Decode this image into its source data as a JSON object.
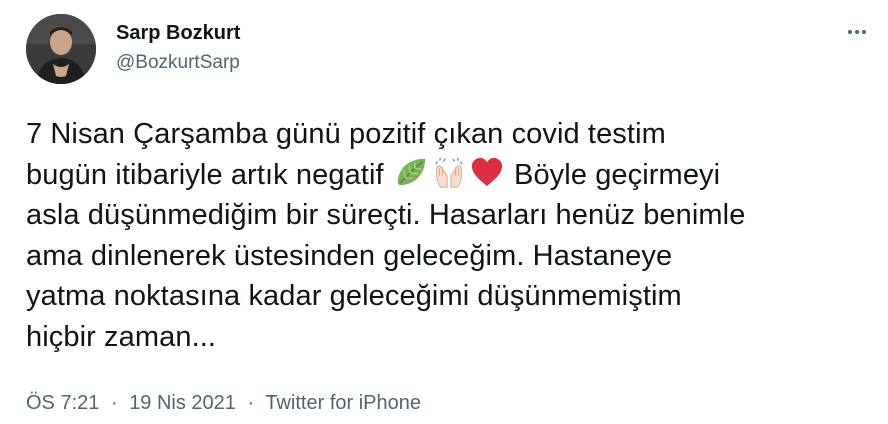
{
  "author": {
    "display_name": "Sarp Bozkurt",
    "handle": "@BozkurtSarp",
    "avatar_icon": "profile-photo"
  },
  "more_icon": "more-options-icon",
  "tweet": {
    "lines": [
      "7 Nisan Çarşamba günü pozitif çıkan covid testim",
      "bugün itibariyle artık negatif",
      "Böyle geçirmeyi",
      "asla düşünmediğim bir süreçti. Hasarları henüz benimle",
      "ama dinlenerek üstesinden geleceğim. Hastaneye",
      "yatma noktasına kadar geleceğimi düşünmemiştim",
      "hiçbir zaman..."
    ],
    "emojis": [
      "leaf-icon",
      "raising-hands-icon",
      "red-heart-icon"
    ]
  },
  "meta": {
    "time": "ÖS 7:21",
    "separator": "·",
    "date": "19 Nis 2021",
    "source": "Twitter for iPhone"
  },
  "colors": {
    "text": "#0f1419",
    "secondary": "#536471",
    "leaf": "#7ac143",
    "heart": "#dd2e44",
    "hands": "#f7dece"
  }
}
